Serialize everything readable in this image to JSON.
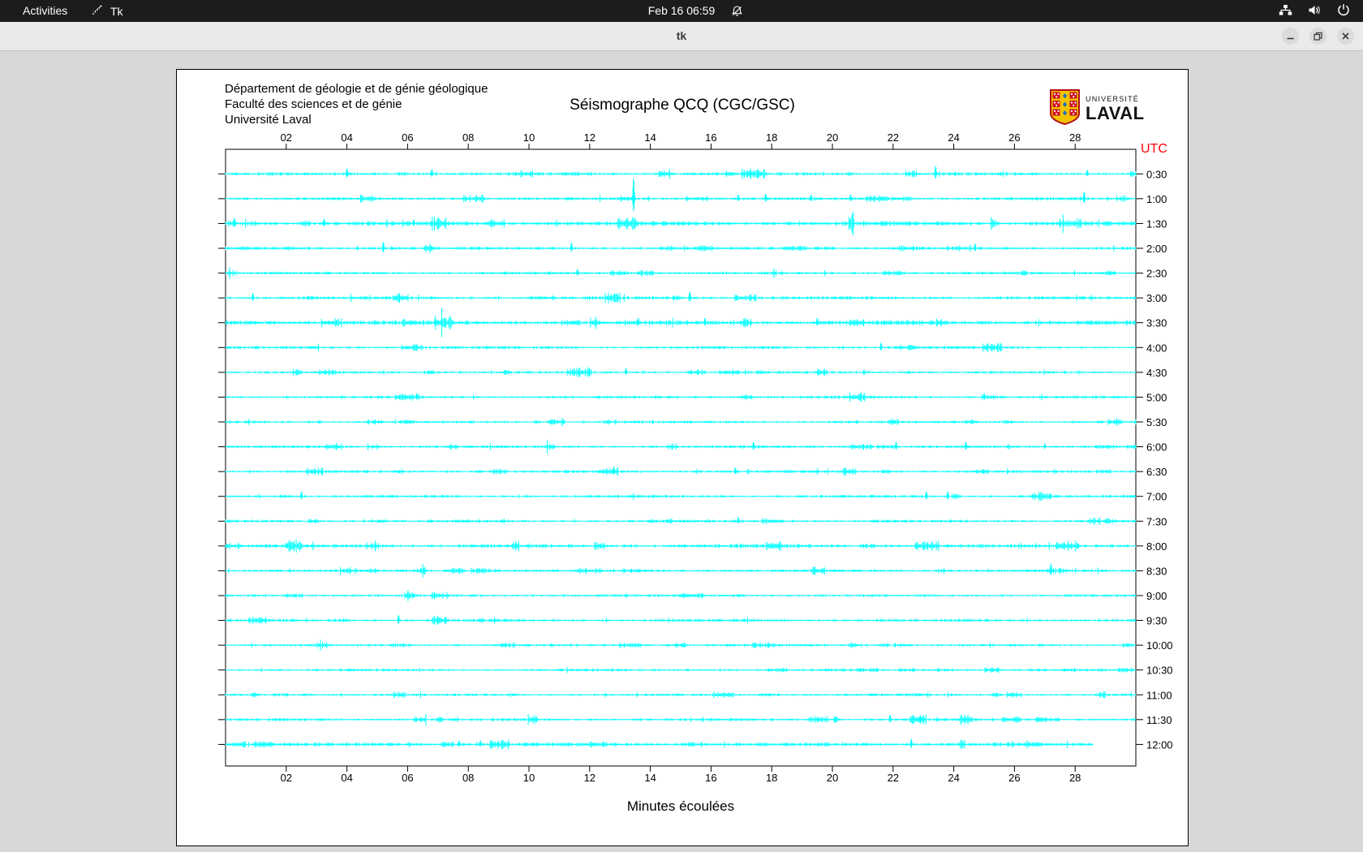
{
  "system_bar": {
    "activities_label": "Activities",
    "app_indicator_label": "Tk",
    "clock": "Feb 16 06:59"
  },
  "window": {
    "title": "tk"
  },
  "document": {
    "header_lines": [
      "Département de géologie et de génie géologique",
      "Faculté des sciences et de génie",
      "Université Laval"
    ],
    "title": "Séismographe QCQ (CGC/GSC)",
    "logo": {
      "top": "UNIVERSITÉ",
      "bottom": "LAVAL"
    },
    "utc_label": "UTC",
    "x_axis_label": "Minutes écoulées"
  },
  "chart_data": {
    "type": "line",
    "title": "Séismographe QCQ (CGC/GSC)",
    "xlabel": "Minutes écoulées",
    "x_range_minutes": [
      0,
      30
    ],
    "x_tick_minutes": [
      2,
      4,
      6,
      8,
      10,
      12,
      14,
      16,
      18,
      20,
      22,
      24,
      26,
      28
    ],
    "x_tick_labels": [
      "02",
      "04",
      "06",
      "08",
      "10",
      "12",
      "14",
      "16",
      "18",
      "20",
      "22",
      "24",
      "26",
      "28"
    ],
    "trace_color": "#00ffff",
    "utc_color": "#ff0000",
    "rows": [
      {
        "label": "0:30",
        "noise": 1.0,
        "end_minute": 30,
        "spikes": [
          [
            4.0,
            7
          ],
          [
            6.8,
            6
          ],
          [
            17.3,
            4
          ],
          [
            23.4,
            10
          ],
          [
            28.4,
            5
          ]
        ]
      },
      {
        "label": "1:00",
        "noise": 1.0,
        "end_minute": 30,
        "spikes": [
          [
            13.45,
            26
          ],
          [
            16.9,
            5
          ],
          [
            17.8,
            6
          ],
          [
            19.3,
            5
          ],
          [
            20.6,
            5
          ],
          [
            28.3,
            9
          ]
        ]
      },
      {
        "label": "1:30",
        "noise": 1.4,
        "end_minute": 30,
        "spikes": [
          [
            0.3,
            7
          ],
          [
            3.25,
            6
          ],
          [
            6.2,
            5
          ]
        ]
      },
      {
        "label": "2:00",
        "noise": 1.0,
        "end_minute": 30,
        "spikes": [
          [
            5.2,
            8
          ],
          [
            11.4,
            7
          ],
          [
            24.7,
            6
          ]
        ]
      },
      {
        "label": "2:30",
        "noise": 0.9,
        "end_minute": 30,
        "spikes": [
          [
            11.6,
            5
          ]
        ]
      },
      {
        "label": "3:00",
        "noise": 1.0,
        "end_minute": 30,
        "spikes": [
          [
            0.9,
            6
          ],
          [
            15.3,
            8
          ]
        ]
      },
      {
        "label": "3:30",
        "noise": 1.4,
        "end_minute": 30,
        "spikes": [
          [
            6.9,
            5
          ],
          [
            13.6,
            6
          ],
          [
            15.8,
            6
          ],
          [
            19.5,
            6
          ]
        ]
      },
      {
        "label": "4:00",
        "noise": 0.9,
        "end_minute": 30,
        "spikes": [
          [
            21.6,
            6
          ]
        ]
      },
      {
        "label": "4:30",
        "noise": 0.8,
        "end_minute": 30,
        "spikes": [
          [
            13.2,
            5
          ]
        ]
      },
      {
        "label": "5:00",
        "noise": 0.9,
        "end_minute": 30,
        "spikes": [
          [
            6.3,
            5
          ],
          [
            25.0,
            5
          ]
        ]
      },
      {
        "label": "5:30",
        "noise": 0.8,
        "end_minute": 30,
        "spikes": []
      },
      {
        "label": "6:00",
        "noise": 0.9,
        "end_minute": 30,
        "spikes": [
          [
            17.4,
            6
          ],
          [
            22.1,
            6
          ],
          [
            24.4,
            6
          ],
          [
            27.0,
            4
          ]
        ]
      },
      {
        "label": "6:30",
        "noise": 0.9,
        "end_minute": 30,
        "spikes": [
          [
            12.8,
            6
          ],
          [
            16.8,
            5
          ]
        ]
      },
      {
        "label": "7:00",
        "noise": 0.9,
        "end_minute": 30,
        "spikes": [
          [
            2.5,
            6
          ],
          [
            23.1,
            6
          ],
          [
            23.8,
            6
          ]
        ]
      },
      {
        "label": "7:30",
        "noise": 0.9,
        "end_minute": 30,
        "spikes": [
          [
            16.9,
            5
          ]
        ]
      },
      {
        "label": "8:00",
        "noise": 1.2,
        "end_minute": 30,
        "spikes": [
          [
            2.0,
            4
          ]
        ]
      },
      {
        "label": "8:30",
        "noise": 0.9,
        "end_minute": 30,
        "spikes": [
          [
            27.2,
            9
          ]
        ]
      },
      {
        "label": "9:00",
        "noise": 0.8,
        "end_minute": 30,
        "spikes": []
      },
      {
        "label": "9:30",
        "noise": 0.9,
        "end_minute": 30,
        "spikes": [
          [
            5.7,
            7
          ]
        ]
      },
      {
        "label": "10:00",
        "noise": 0.8,
        "end_minute": 30,
        "spikes": []
      },
      {
        "label": "10:30",
        "noise": 0.8,
        "end_minute": 30,
        "spikes": []
      },
      {
        "label": "11:00",
        "noise": 0.8,
        "end_minute": 30,
        "spikes": []
      },
      {
        "label": "11:30",
        "noise": 0.9,
        "end_minute": 30,
        "spikes": [
          [
            21.9,
            6
          ],
          [
            22.9,
            5
          ]
        ]
      },
      {
        "label": "12:00",
        "noise": 1.2,
        "end_minute": 28.6,
        "spikes": [
          [
            7.7,
            5
          ],
          [
            8.4,
            5
          ],
          [
            22.6,
            7
          ]
        ]
      }
    ]
  }
}
